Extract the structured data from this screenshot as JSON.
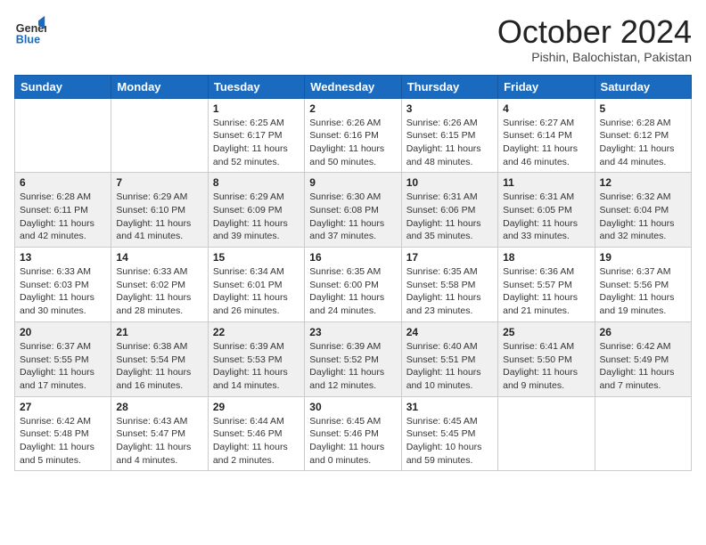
{
  "header": {
    "logo_general": "General",
    "logo_blue": "Blue",
    "month_title": "October 2024",
    "location": "Pishin, Balochistan, Pakistan"
  },
  "weekdays": [
    "Sunday",
    "Monday",
    "Tuesday",
    "Wednesday",
    "Thursday",
    "Friday",
    "Saturday"
  ],
  "weeks": [
    [
      {
        "day": "",
        "info": ""
      },
      {
        "day": "",
        "info": ""
      },
      {
        "day": "1",
        "info": "Sunrise: 6:25 AM\nSunset: 6:17 PM\nDaylight: 11 hours and 52 minutes."
      },
      {
        "day": "2",
        "info": "Sunrise: 6:26 AM\nSunset: 6:16 PM\nDaylight: 11 hours and 50 minutes."
      },
      {
        "day": "3",
        "info": "Sunrise: 6:26 AM\nSunset: 6:15 PM\nDaylight: 11 hours and 48 minutes."
      },
      {
        "day": "4",
        "info": "Sunrise: 6:27 AM\nSunset: 6:14 PM\nDaylight: 11 hours and 46 minutes."
      },
      {
        "day": "5",
        "info": "Sunrise: 6:28 AM\nSunset: 6:12 PM\nDaylight: 11 hours and 44 minutes."
      }
    ],
    [
      {
        "day": "6",
        "info": "Sunrise: 6:28 AM\nSunset: 6:11 PM\nDaylight: 11 hours and 42 minutes."
      },
      {
        "day": "7",
        "info": "Sunrise: 6:29 AM\nSunset: 6:10 PM\nDaylight: 11 hours and 41 minutes."
      },
      {
        "day": "8",
        "info": "Sunrise: 6:29 AM\nSunset: 6:09 PM\nDaylight: 11 hours and 39 minutes."
      },
      {
        "day": "9",
        "info": "Sunrise: 6:30 AM\nSunset: 6:08 PM\nDaylight: 11 hours and 37 minutes."
      },
      {
        "day": "10",
        "info": "Sunrise: 6:31 AM\nSunset: 6:06 PM\nDaylight: 11 hours and 35 minutes."
      },
      {
        "day": "11",
        "info": "Sunrise: 6:31 AM\nSunset: 6:05 PM\nDaylight: 11 hours and 33 minutes."
      },
      {
        "day": "12",
        "info": "Sunrise: 6:32 AM\nSunset: 6:04 PM\nDaylight: 11 hours and 32 minutes."
      }
    ],
    [
      {
        "day": "13",
        "info": "Sunrise: 6:33 AM\nSunset: 6:03 PM\nDaylight: 11 hours and 30 minutes."
      },
      {
        "day": "14",
        "info": "Sunrise: 6:33 AM\nSunset: 6:02 PM\nDaylight: 11 hours and 28 minutes."
      },
      {
        "day": "15",
        "info": "Sunrise: 6:34 AM\nSunset: 6:01 PM\nDaylight: 11 hours and 26 minutes."
      },
      {
        "day": "16",
        "info": "Sunrise: 6:35 AM\nSunset: 6:00 PM\nDaylight: 11 hours and 24 minutes."
      },
      {
        "day": "17",
        "info": "Sunrise: 6:35 AM\nSunset: 5:58 PM\nDaylight: 11 hours and 23 minutes."
      },
      {
        "day": "18",
        "info": "Sunrise: 6:36 AM\nSunset: 5:57 PM\nDaylight: 11 hours and 21 minutes."
      },
      {
        "day": "19",
        "info": "Sunrise: 6:37 AM\nSunset: 5:56 PM\nDaylight: 11 hours and 19 minutes."
      }
    ],
    [
      {
        "day": "20",
        "info": "Sunrise: 6:37 AM\nSunset: 5:55 PM\nDaylight: 11 hours and 17 minutes."
      },
      {
        "day": "21",
        "info": "Sunrise: 6:38 AM\nSunset: 5:54 PM\nDaylight: 11 hours and 16 minutes."
      },
      {
        "day": "22",
        "info": "Sunrise: 6:39 AM\nSunset: 5:53 PM\nDaylight: 11 hours and 14 minutes."
      },
      {
        "day": "23",
        "info": "Sunrise: 6:39 AM\nSunset: 5:52 PM\nDaylight: 11 hours and 12 minutes."
      },
      {
        "day": "24",
        "info": "Sunrise: 6:40 AM\nSunset: 5:51 PM\nDaylight: 11 hours and 10 minutes."
      },
      {
        "day": "25",
        "info": "Sunrise: 6:41 AM\nSunset: 5:50 PM\nDaylight: 11 hours and 9 minutes."
      },
      {
        "day": "26",
        "info": "Sunrise: 6:42 AM\nSunset: 5:49 PM\nDaylight: 11 hours and 7 minutes."
      }
    ],
    [
      {
        "day": "27",
        "info": "Sunrise: 6:42 AM\nSunset: 5:48 PM\nDaylight: 11 hours and 5 minutes."
      },
      {
        "day": "28",
        "info": "Sunrise: 6:43 AM\nSunset: 5:47 PM\nDaylight: 11 hours and 4 minutes."
      },
      {
        "day": "29",
        "info": "Sunrise: 6:44 AM\nSunset: 5:46 PM\nDaylight: 11 hours and 2 minutes."
      },
      {
        "day": "30",
        "info": "Sunrise: 6:45 AM\nSunset: 5:46 PM\nDaylight: 11 hours and 0 minutes."
      },
      {
        "day": "31",
        "info": "Sunrise: 6:45 AM\nSunset: 5:45 PM\nDaylight: 10 hours and 59 minutes."
      },
      {
        "day": "",
        "info": ""
      },
      {
        "day": "",
        "info": ""
      }
    ]
  ]
}
